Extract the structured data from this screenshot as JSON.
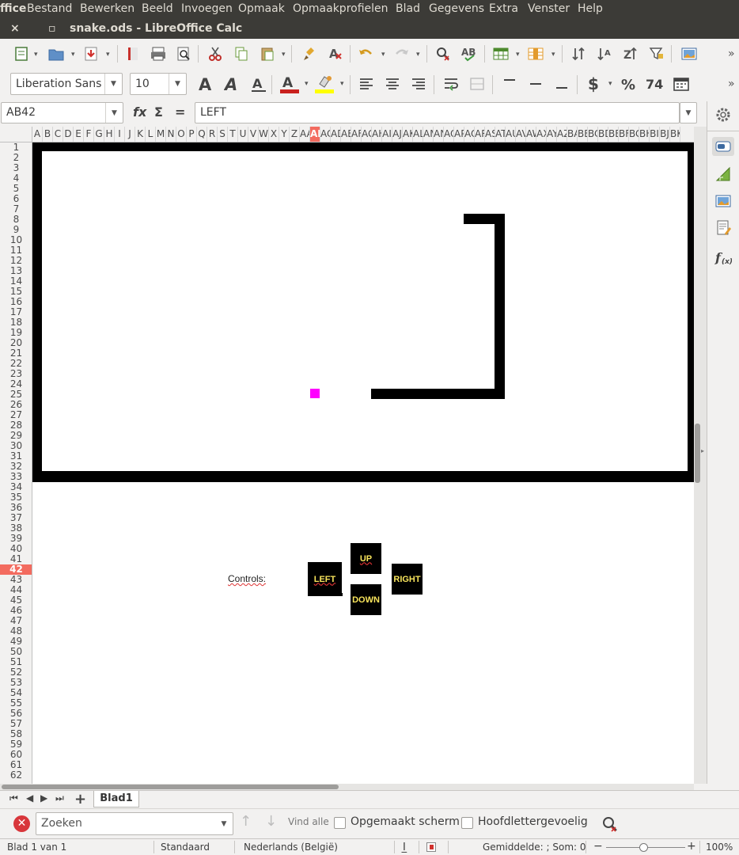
{
  "menubar": {
    "app_name": "ffice",
    "items": [
      "Bestand",
      "Bewerken",
      "Beeld",
      "Invoegen",
      "Opmaak",
      "Opmaakprofielen",
      "Blad",
      "Gegevens",
      "Extra",
      "Venster",
      "Help"
    ]
  },
  "titlebar": {
    "close_glyph": "×",
    "restore_glyph": "▫",
    "title": "snake.ods - LibreOffice Calc"
  },
  "format_toolbar": {
    "font_name": "Liberation Sans",
    "font_size": "10"
  },
  "formula": {
    "name_box": "AB42",
    "content": "LEFT",
    "fx_label": "fx",
    "sum_label": "Σ",
    "equals_label": "="
  },
  "columns": [
    "A",
    "B",
    "C",
    "D",
    "E",
    "F",
    "G",
    "H",
    "I",
    "J",
    "K",
    "L",
    "M",
    "N",
    "O",
    "P",
    "Q",
    "R",
    "S",
    "T",
    "U",
    "V",
    "W",
    "X",
    "Y",
    "Z",
    "AA",
    "AB",
    "AC",
    "AD",
    "AE",
    "AF",
    "AG",
    "AH",
    "AI",
    "AJ",
    "AK",
    "AL",
    "AM",
    "AN",
    "AO",
    "AP",
    "AQ",
    "AR",
    "AS",
    "AT",
    "AU",
    "AV",
    "AW",
    "AX",
    "AY",
    "AZ",
    "BA",
    "BB",
    "BC",
    "BD",
    "BE",
    "BF",
    "BG",
    "BH",
    "BI",
    "BJ",
    "BK"
  ],
  "active_column": "AB",
  "active_row": "42",
  "row_count": 62,
  "game": {
    "controls_label": "Controls:",
    "buttons": {
      "up": "UP",
      "left": "LEFT",
      "right": "RIGHT",
      "down": "DOWN"
    },
    "food_color": "#ff00ff",
    "wall_color": "#000000"
  },
  "tabs": {
    "sheet_name": "Blad1",
    "add_glyph": "+"
  },
  "findbar": {
    "placeholder": "Zoeken",
    "find_all": "Vind alle",
    "formatted_display": "Opgemaakt scherm",
    "match_case": "Hoofdlettergevoelig"
  },
  "statusbar": {
    "sheet_info": "Blad 1 van 1",
    "page_style": "Standaard",
    "language": "Nederlands (België)",
    "summary": "Gemiddelde: ; Som: 0",
    "zoom": "100%"
  },
  "colors": {
    "menubar_bg": "#3c3b37",
    "active_header": "#f36b5f",
    "control_text": "#f8e45c"
  }
}
